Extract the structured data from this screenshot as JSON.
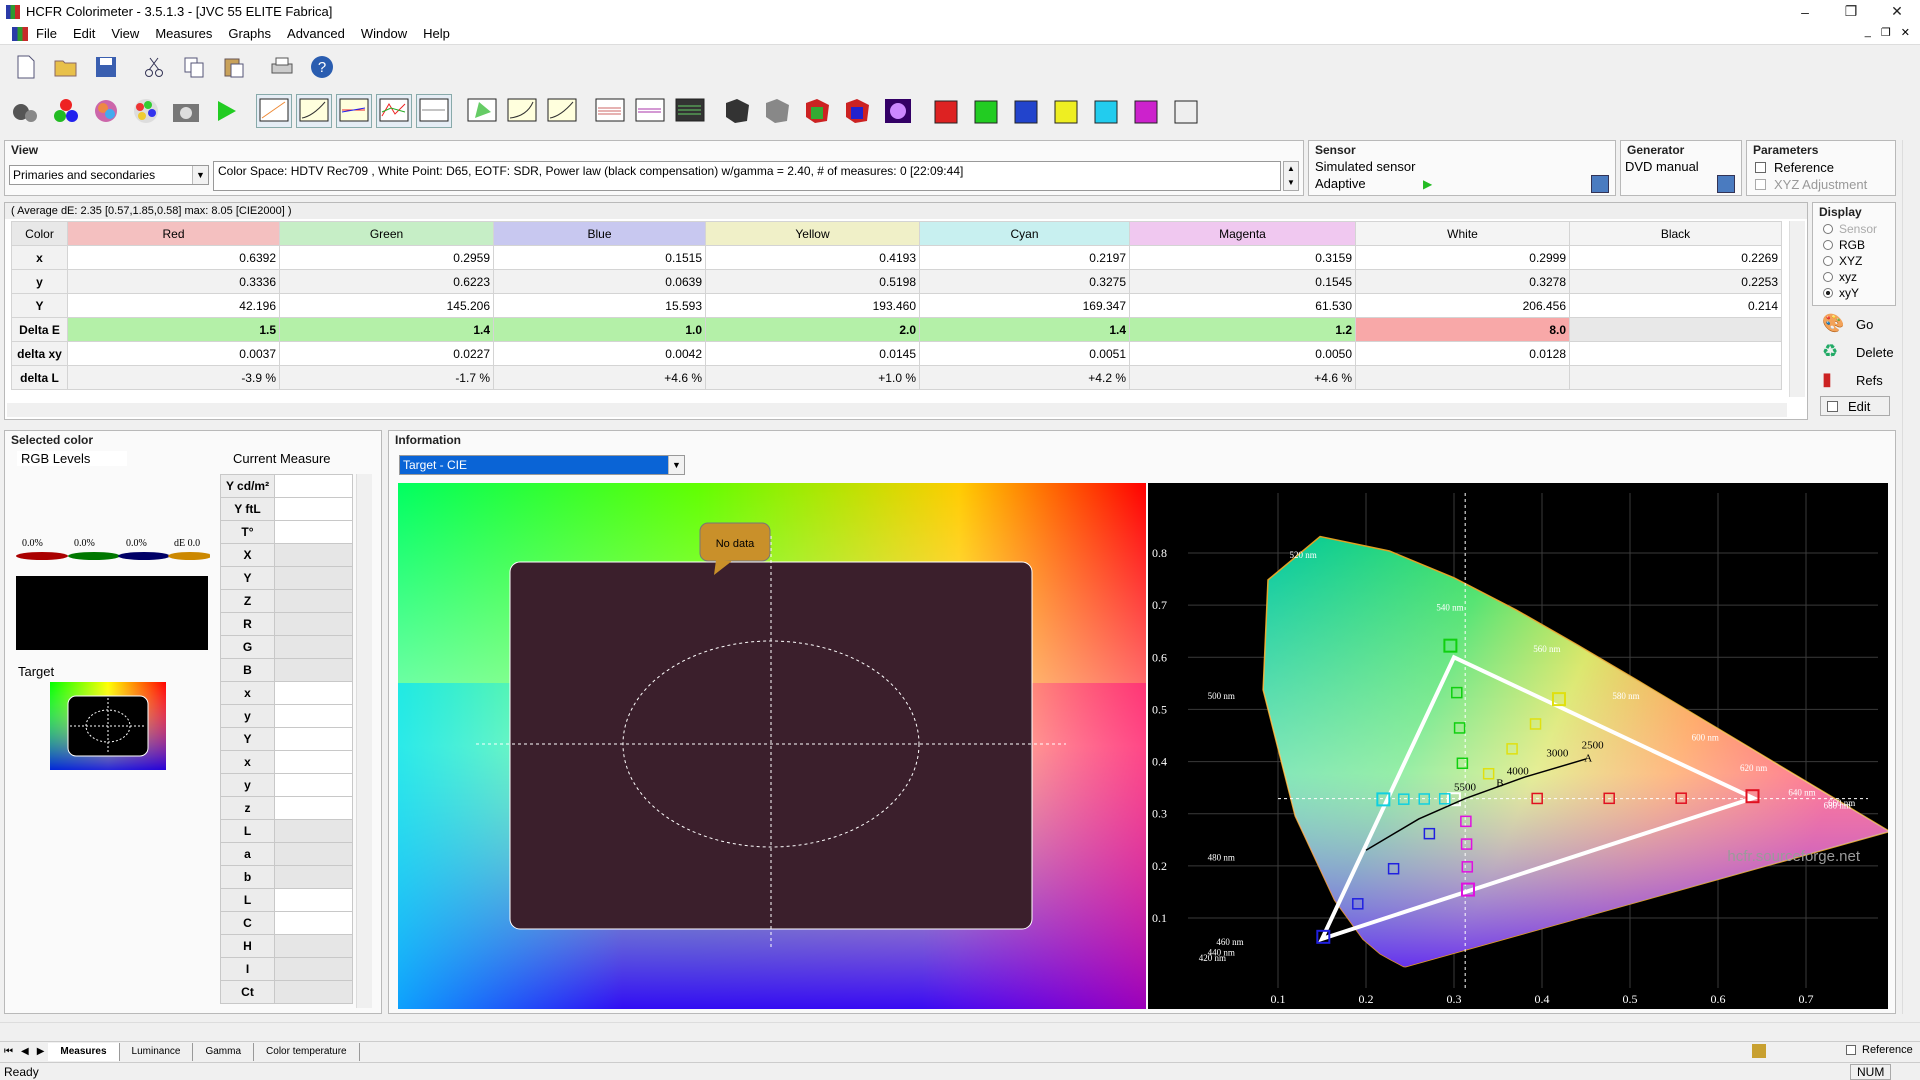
{
  "window": {
    "title": "HCFR Colorimeter - 3.5.1.3 - [JVC 55 ELITE Fabrica]",
    "min": "–",
    "max": "❐",
    "close": "✕"
  },
  "menu": [
    "File",
    "Edit",
    "View",
    "Measures",
    "Graphs",
    "Advanced",
    "Window",
    "Help"
  ],
  "mdi": {
    "min": "_",
    "restore": "❐",
    "close": "✕"
  },
  "toolbar1": [
    "new-icon",
    "open-icon",
    "save-icon",
    "cut-icon",
    "copy-icon",
    "paste-icon",
    "print-icon",
    "help-icon"
  ],
  "toolbar2": [
    "sensor-icon",
    "rgb-icon",
    "spectrum-icon",
    "palette-icon",
    "camera-icon",
    "play-icon",
    "chart1-icon",
    "chart2-icon",
    "chart3-icon",
    "chart4-icon",
    "chart5-icon",
    "cie-icon",
    "lum-icon",
    "lum2-icon",
    "gamma-icon",
    "gamma2-icon",
    "nearblack-icon",
    "paint1-icon",
    "paint2-icon",
    "paint3-icon",
    "paint4-icon",
    "paint5-icon",
    "cube-red-icon",
    "cube-green-icon",
    "cube-blue-icon",
    "cube-yellow-icon",
    "cube-cyan-icon",
    "cube-magenta-icon",
    "cube-white-icon"
  ],
  "view": {
    "title": "View",
    "combo": "Primaries and secondaries",
    "info": "Color Space: HDTV Rec709 , White Point: D65, EOTF:  SDR, Power law (black compensation) w/gamma = 2.40, # of measures: 0 [22:09:44]"
  },
  "sensor": {
    "title": "Sensor",
    "name": "Simulated sensor",
    "mode": "Adaptive"
  },
  "generator": {
    "title": "Generator",
    "name": "DVD manual"
  },
  "parameters": {
    "title": "Parameters",
    "reference": "Reference",
    "xyz_adj": "XYZ Adjustment"
  },
  "grid": {
    "avg": "( Average dE: 2.35 [0.57,1.85,0.58] max: 8.05 [CIE2000] )",
    "columns": [
      "Color",
      "Red",
      "Green",
      "Blue",
      "Yellow",
      "Cyan",
      "Magenta",
      "White",
      "Black"
    ],
    "col_colors": [
      "#e8e8e8",
      "#f4c0c0",
      "#c6eec6",
      "#c8c8f0",
      "#f0f0c8",
      "#c8f0f0",
      "#f0c8f0",
      "#f4f4f4",
      "#f4f4f4"
    ],
    "rows": [
      {
        "label": "x",
        "values": [
          "0.6392",
          "0.2959",
          "0.1515",
          "0.4193",
          "0.2197",
          "0.3159",
          "0.2999",
          "0.2269"
        ]
      },
      {
        "label": "y",
        "values": [
          "0.3336",
          "0.6223",
          "0.0639",
          "0.5198",
          "0.3275",
          "0.1545",
          "0.3278",
          "0.2253"
        ]
      },
      {
        "label": "Y",
        "values": [
          "42.196",
          "145.206",
          "15.593",
          "193.460",
          "169.347",
          "61.530",
          "206.456",
          "0.214"
        ]
      },
      {
        "label": "Delta E",
        "values": [
          "1.5",
          "1.4",
          "1.0",
          "2.0",
          "1.4",
          "1.2",
          "8.0",
          ""
        ]
      },
      {
        "label": "delta xy",
        "values": [
          "0.0037",
          "0.0227",
          "0.0042",
          "0.0145",
          "0.0051",
          "0.0050",
          "0.0128",
          ""
        ]
      },
      {
        "label": "delta L",
        "values": [
          "-3.9 %",
          "-1.7 %",
          "+4.6 %",
          "+1.0 %",
          "+4.2 %",
          "+4.6 %",
          "",
          ""
        ]
      }
    ]
  },
  "display": {
    "title": "Display",
    "options": [
      "Sensor",
      "RGB",
      "XYZ",
      "xyz",
      "xyY"
    ],
    "selected": "xyY"
  },
  "side_buttons": {
    "go": "Go",
    "delete": "Delete",
    "refs": "Refs",
    "edit": "Edit"
  },
  "selected_color": {
    "title": "Selected color",
    "rgb_levels": "RGB Levels",
    "current_measure": "Current Measure",
    "levels": [
      "0.0%",
      "0.0%",
      "0.0%",
      "dE 0.0"
    ],
    "target": "Target",
    "rows": [
      "Y cd/m²",
      "Y ftL",
      "T°",
      "X",
      "Y",
      "Z",
      "R",
      "G",
      "B",
      "x",
      "y",
      "Y",
      "x",
      "y",
      "z",
      "L",
      "a",
      "b",
      "L",
      "C",
      "H",
      "I",
      "Ct"
    ]
  },
  "information": {
    "title": "Information",
    "combo": "Target - CIE",
    "no_data": "No data",
    "watermark": "hcfr.sourceforge.net"
  },
  "cie": {
    "x_ticks": [
      "0.1",
      "0.2",
      "0.3",
      "0.4",
      "0.5",
      "0.6",
      "0.7"
    ],
    "y_ticks": [
      "0.1",
      "0.2",
      "0.3",
      "0.4",
      "0.5",
      "0.6",
      "0.7",
      "0.8"
    ],
    "wl_labels": [
      "520 nm",
      "540 nm",
      "560 nm",
      "580 nm",
      "600 nm",
      "620 nm",
      "640 nm",
      "660 nm",
      "680 nm",
      "500 nm",
      "480 nm",
      "460 nm",
      "440 nm",
      "420 nm"
    ],
    "cct_labels": [
      "3000",
      "4000",
      "5500",
      "2500"
    ],
    "illuminants": [
      "A",
      "B"
    ]
  },
  "chart_data": {
    "type": "scatter",
    "title": "",
    "xlabel": "",
    "ylabel": "",
    "xlim": [
      0.05,
      0.75
    ],
    "ylim": [
      0.0,
      0.9
    ],
    "series": [
      {
        "name": "",
        "points": [
          [
            0.6392,
            0.3336
          ],
          [
            0.2959,
            0.6223
          ],
          [
            0.1515,
            0.0639
          ],
          [
            0.4193,
            0.5198
          ],
          [
            0.2197,
            0.3275
          ],
          [
            0.3159,
            0.1545
          ],
          [
            0.2999,
            0.3278
          ]
        ]
      }
    ]
  },
  "tabs": [
    "Measures",
    "Luminance",
    "Gamma",
    "Color temperature"
  ],
  "status": {
    "left": "Ready",
    "num": "NUM",
    "reference": "Reference"
  }
}
